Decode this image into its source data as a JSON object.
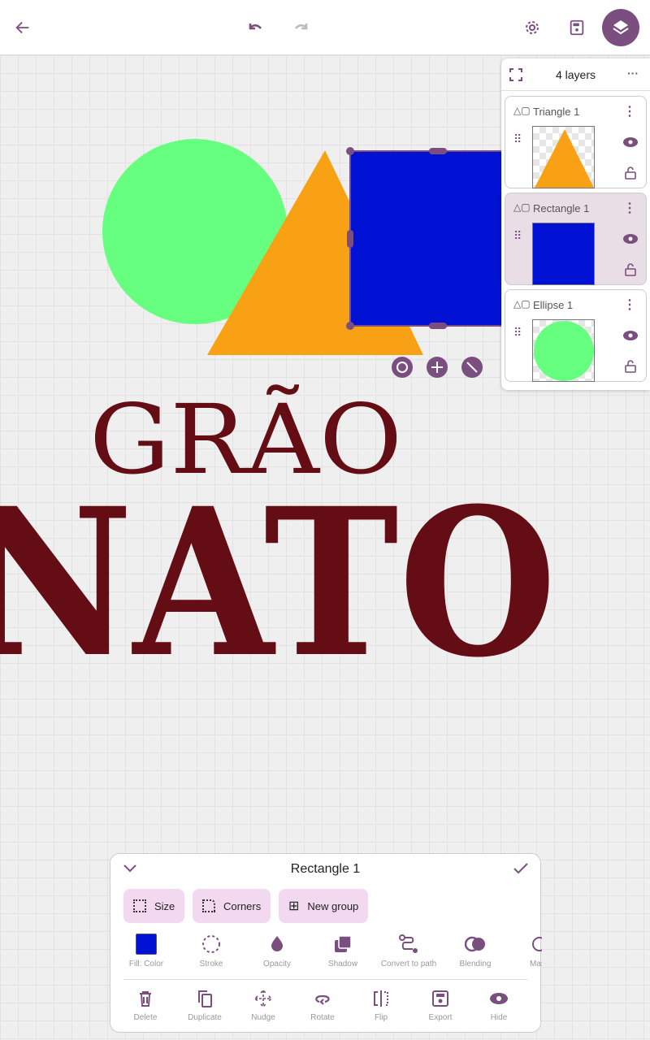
{
  "topbar": {
    "icons": [
      "arrow-left-icon",
      "undo-icon",
      "redo-icon",
      "gear-icon",
      "save-icon",
      "layers-icon"
    ]
  },
  "colors": {
    "accent": "#7a4f80",
    "circle": "#66ff80",
    "triangle": "#f9a114",
    "rectangle": "#0011d4",
    "text": "#650d15"
  },
  "canvas": {
    "text_line1": "GRÃO",
    "text_line2": "NATO"
  },
  "layers_panel": {
    "title": "4 layers",
    "layers": [
      {
        "name": "Triangle 1",
        "selected": false
      },
      {
        "name": "Rectangle 1",
        "selected": true
      },
      {
        "name": "Ellipse 1",
        "selected": false
      }
    ]
  },
  "sheet": {
    "title": "Rectangle 1",
    "chips": [
      "Size",
      "Corners",
      "New group"
    ],
    "tools": [
      "Fill: Color",
      "Stroke",
      "Opacity",
      "Shadow",
      "Convert to path",
      "Blending",
      "Mask"
    ],
    "actions": [
      "Delete",
      "Duplicate",
      "Nudge",
      "Rotate",
      "Flip",
      "Export",
      "Hide"
    ]
  }
}
